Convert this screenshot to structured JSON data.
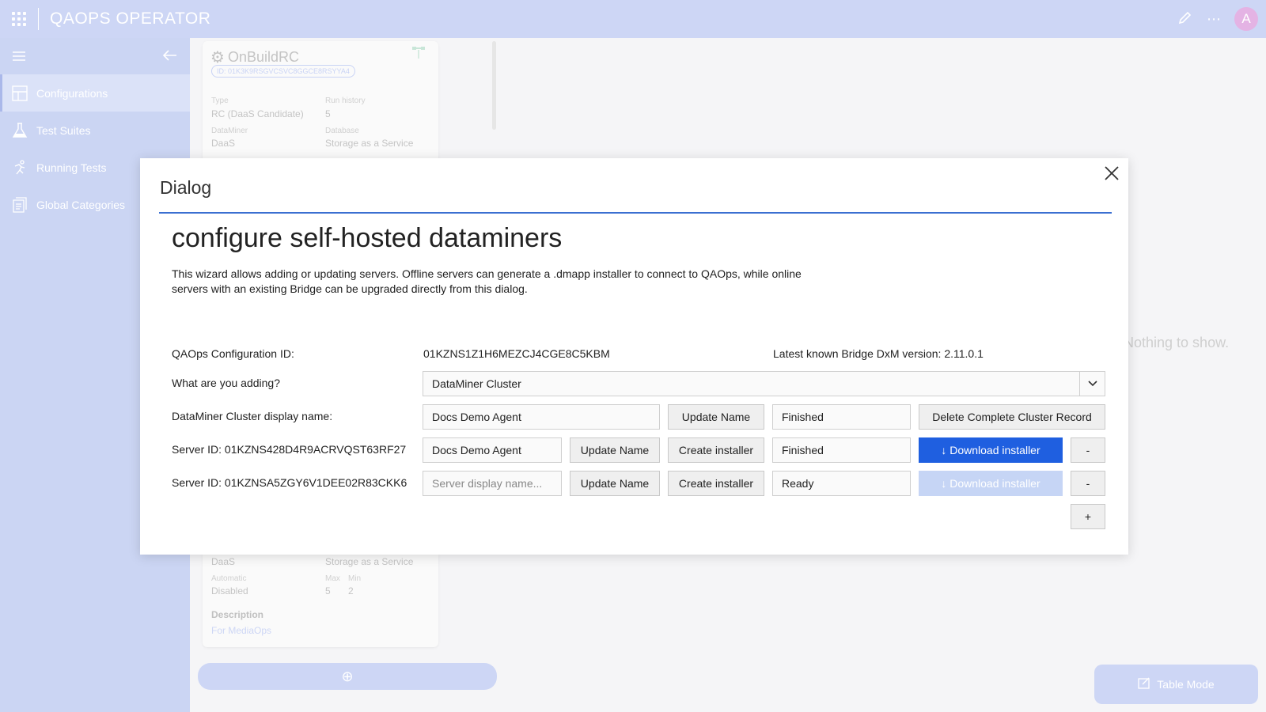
{
  "app": {
    "title": "QAOPS OPERATOR",
    "avatar": "A"
  },
  "sidebar": {
    "items": [
      {
        "label": "Configurations",
        "icon": "configurations-icon",
        "active": true
      },
      {
        "label": "Test Suites",
        "icon": "flask-icon"
      },
      {
        "label": "Running Tests",
        "icon": "running-icon"
      },
      {
        "label": "Global Categories",
        "icon": "categories-icon"
      }
    ]
  },
  "background": {
    "card": {
      "title": "OnBuildRC",
      "id_badge": "ID: 01K3K9RSGVCSVC8GGCE8RSYYA4",
      "type_label": "Type",
      "type_value": "RC (DaaS Candidate)",
      "run_history_label": "Run history",
      "run_history_value": "5",
      "dataminer_label": "DataMiner",
      "dataminer_value": "DaaS",
      "database_label": "Database",
      "database_value": "Storage as a Service",
      "lower_dataminer_value": "DaaS",
      "lower_database_value": "Storage as a Service",
      "automatic_label": "Automatic",
      "automatic_value": "Disabled",
      "max_label": "Max",
      "max_value": "5",
      "min_label": "Min",
      "min_value": "2",
      "description_label": "Description",
      "description_value": "For MediaOps"
    },
    "empty_text": "Nothing to show.",
    "table_mode_label": "Table Mode"
  },
  "dialog": {
    "title": "Dialog",
    "heading": "configure self-hosted dataminers",
    "description": "This wizard allows adding or updating servers. Offline servers can generate a .dmapp installer to connect to QAOps, while online servers with an existing Bridge can be upgraded directly from this dialog.",
    "config_id_label": "QAOps Configuration ID:",
    "config_id_value": "01KZNS1Z1H6MEZCJ4CGE8C5KBM",
    "bridge_version": "Latest known Bridge DxM version: 2.11.0.1",
    "adding_label": "What are you adding?",
    "adding_value": "DataMiner Cluster",
    "cluster_label": "DataMiner Cluster display name:",
    "cluster_name": "Docs Demo Agent",
    "cluster_update_label": "Update Name",
    "cluster_status": "Finished",
    "delete_label": "Delete Complete Cluster Record",
    "servers": [
      {
        "label": "Server ID: 01KZNS428D4R9ACRVQST63RF27",
        "name": "Docs Demo Agent",
        "placeholder": "",
        "update_label": "Update Name",
        "create_label": "Create installer",
        "status": "Finished",
        "download_label": "↓ Download installer",
        "download_enabled": true,
        "remove_label": "-"
      },
      {
        "label": "Server ID: 01KZNSA5ZGY6V1DEE02R83CKK6",
        "name": "",
        "placeholder": "Server display name...",
        "update_label": "Update Name",
        "create_label": "Create installer",
        "status": "Ready",
        "download_label": "↓ Download installer",
        "download_enabled": false,
        "remove_label": "-"
      }
    ],
    "add_label": "+"
  },
  "colors": {
    "accent": "#1f5fe0",
    "topbar": "#cdd6f5",
    "sidebar": "#cbd5f3",
    "rule": "#3b6fd1"
  }
}
